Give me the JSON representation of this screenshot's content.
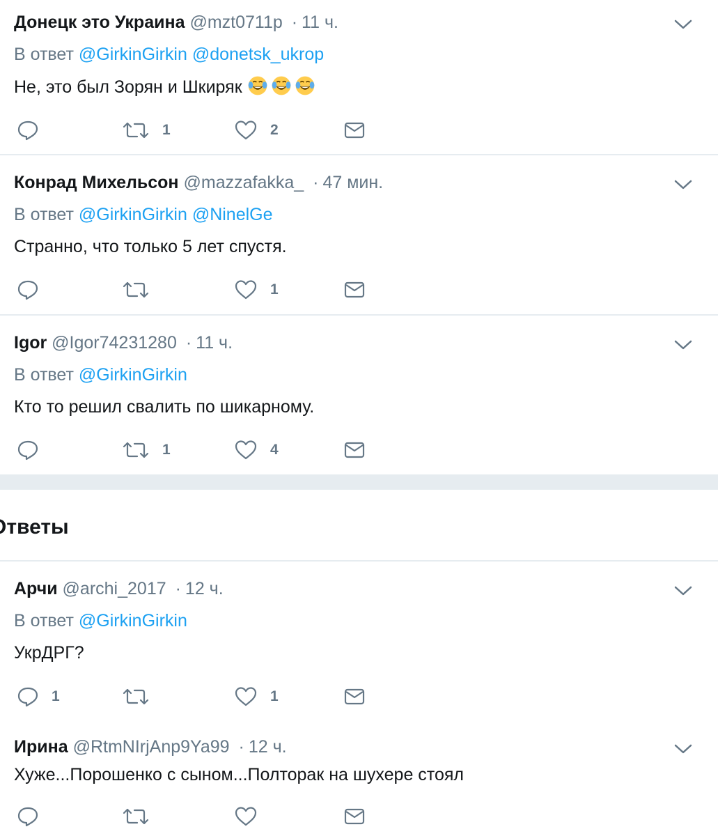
{
  "tweets": [
    {
      "name": "Донецк это Украина",
      "handle": "@mzt0711p",
      "dot": "·",
      "time": "11 ч.",
      "reply_prefix": "В ответ",
      "reply_to": [
        "@GirkinGirkin",
        "@donetsk_ukrop"
      ],
      "text": "Не, это был Зорян и Шкиряк",
      "emoji": [
        "face-with-tears-of-joy",
        "face-with-tears-of-joy",
        "face-with-tears-of-joy"
      ],
      "counts": {
        "reply": "",
        "retweet": "1",
        "like": "2"
      }
    },
    {
      "name": "Конрад Михельсон",
      "handle": "@mazzafakka_",
      "dot": "·",
      "time": "47 мин.",
      "reply_prefix": "В ответ",
      "reply_to": [
        "@GirkinGirkin",
        "@NinelGe"
      ],
      "text": "Странно, что только 5 лет спустя.",
      "counts": {
        "reply": "",
        "retweet": "",
        "like": "1"
      }
    },
    {
      "name": "Igor",
      "handle": "@Igor74231280",
      "dot": "·",
      "time": "11 ч.",
      "reply_prefix": "В ответ",
      "reply_to": [
        "@GirkinGirkin"
      ],
      "text": "Кто то решил свалить по шикарному.",
      "counts": {
        "reply": "",
        "retweet": "1",
        "like": "4"
      }
    },
    {
      "name": "Арчи",
      "handle": "@archi_2017",
      "dot": "·",
      "time": "12 ч.",
      "reply_prefix": "В ответ",
      "reply_to": [
        "@GirkinGirkin"
      ],
      "text": "УкрДРГ?",
      "counts": {
        "reply": "1",
        "retweet": "",
        "like": "1"
      }
    },
    {
      "name": "Ирина",
      "handle": "@RtmNIrjAnp9Ya99",
      "dot": "·",
      "time": "12 ч.",
      "text": "Хуже...Порошенко с сыном...Полторак на шухере стоял",
      "counts": {
        "reply": "",
        "retweet": "",
        "like": ""
      }
    }
  ],
  "section_title": "Ответы",
  "icons": {
    "reply": "reply-bubble-icon",
    "retweet": "retweet-icon",
    "like": "heart-icon",
    "dm": "envelope-icon",
    "menu": "chevron-down-icon"
  },
  "colors": {
    "link": "#1da1f2",
    "muted": "#657786",
    "text": "#14171a",
    "divider": "#e6ecf0"
  }
}
